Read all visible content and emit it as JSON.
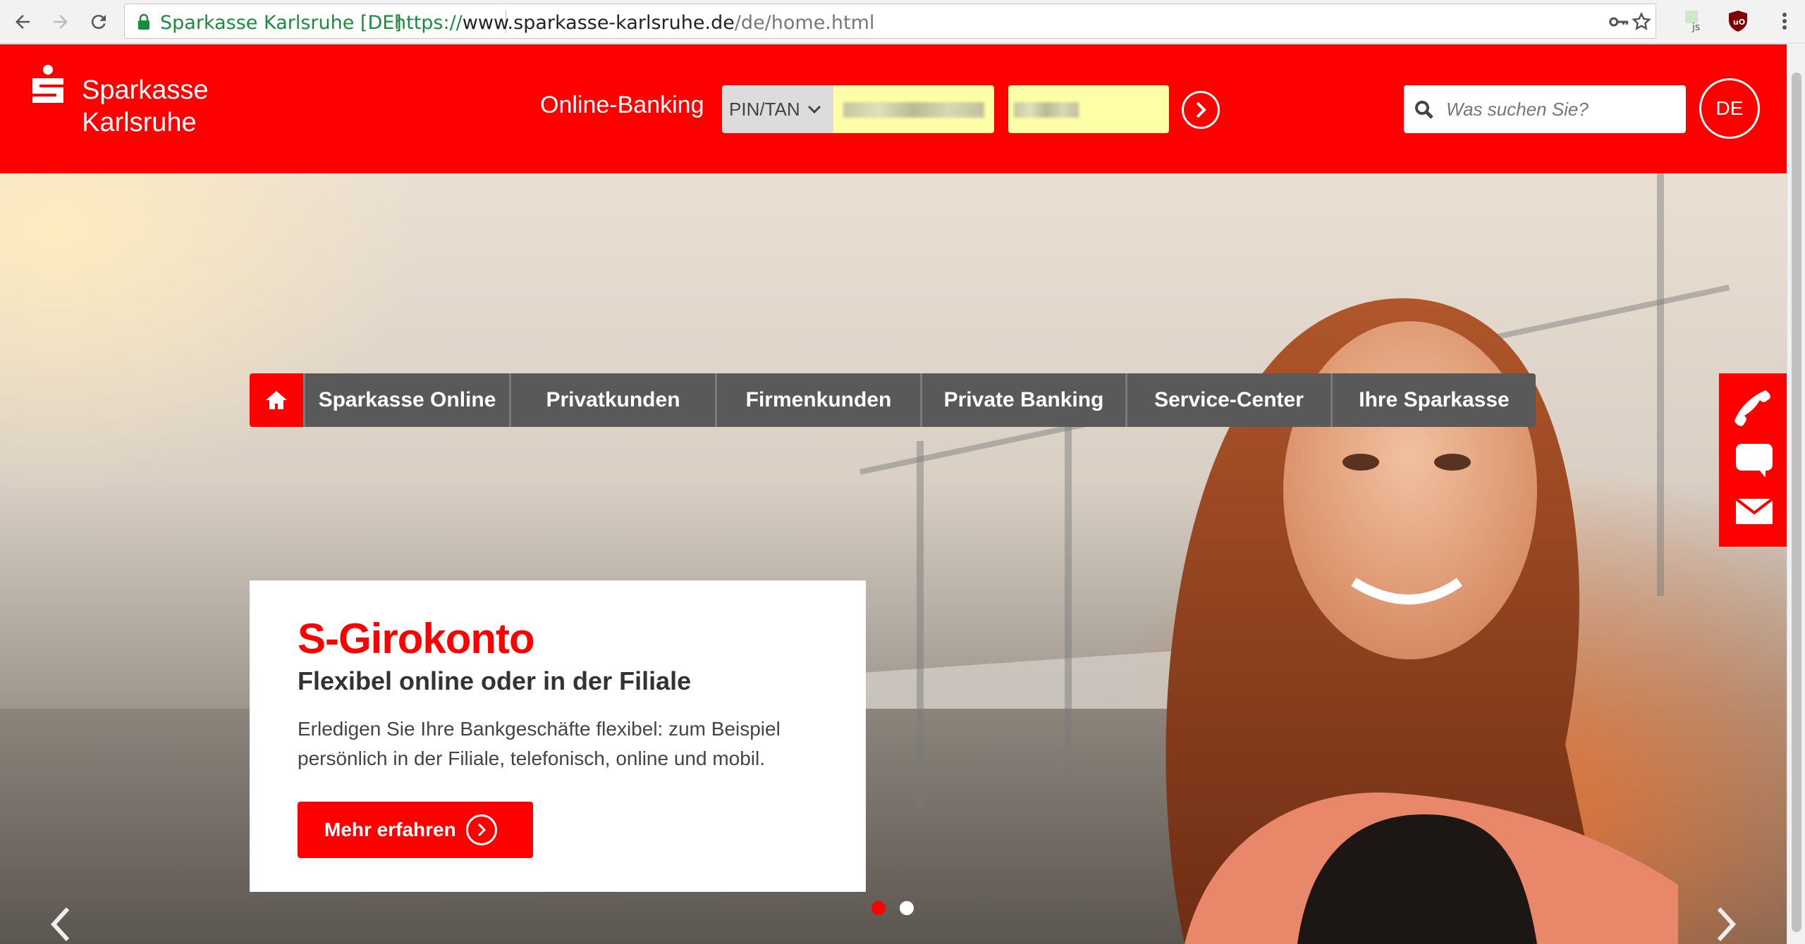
{
  "browser": {
    "site_name": "Sparkasse Karlsruhe [DE]",
    "url_scheme": "https://",
    "url_host": "www.sparkasse-karlsruhe.de",
    "url_path": "/de/home.html",
    "icons": [
      "back-icon",
      "forward-icon",
      "reload-icon",
      "lock-icon",
      "key-icon",
      "star-icon",
      "js-extension-icon",
      "ublock-icon",
      "menu-icon"
    ]
  },
  "header": {
    "logo_line1": "Sparkasse",
    "logo_line2": "Karlsruhe",
    "online_banking_label": "Online-Banking",
    "login_method": "PIN/TAN",
    "search_placeholder": "Was suchen Sie?",
    "language": "DE"
  },
  "nav": {
    "items": [
      {
        "label": "Sparkasse Online"
      },
      {
        "label": "Privatkunden"
      },
      {
        "label": "Firmenkunden"
      },
      {
        "label": "Private Banking"
      },
      {
        "label": "Service-Center"
      },
      {
        "label": "Ihre Sparkasse"
      }
    ]
  },
  "teaser": {
    "title": "S-Girokonto",
    "subtitle": "Flexibel online oder in der Filiale",
    "text": "Erledigen Sie Ihre Bankgeschäfte flexibel: zum Beispiel persönlich in der Filiale, telefonisch, online und mobil.",
    "button_label": "Mehr erfahren"
  },
  "carousel": {
    "slide_count": 2,
    "active_slide": 1
  },
  "colors": {
    "brand_red": "#ff0000",
    "nav_gray": "#595959",
    "autofill_yellow": "#ffffa8"
  }
}
